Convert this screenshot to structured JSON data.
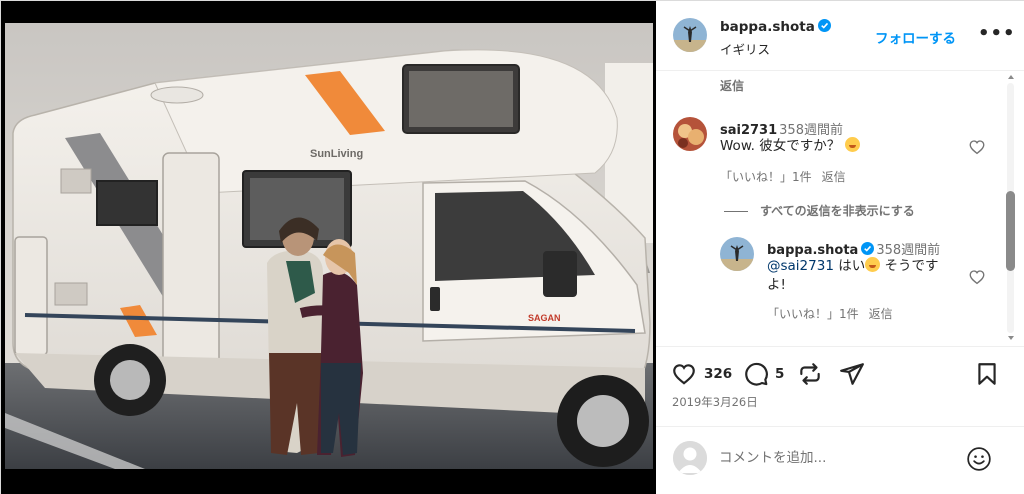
{
  "post": {
    "author": "bappa.shota",
    "location": "イギリス",
    "follow_label": "フォローする",
    "more_label": "•••",
    "likes": "326",
    "comment_count": "5",
    "date": "2019年3月26日",
    "photo_text": {
      "brand": "SunLiving",
      "model": "SAGAN"
    }
  },
  "comments": {
    "top_reply_label": "返信",
    "items": [
      {
        "user": "sai2731",
        "time": "358週間前",
        "text": "Wow. 彼女ですか？",
        "likes_label": "「いいね！」1件",
        "reply_label": "返信"
      }
    ],
    "hide_replies_label": "すべての返信を非表示にする",
    "replies": [
      {
        "user": "bappa.shota",
        "time": "358週間前",
        "mention": "@sai2731",
        "text_before_emoji": " はい",
        "text_after_emoji": " そうです",
        "text_line2": "よ!",
        "likes_label": "「いいね！」1件",
        "reply_label": "返信"
      }
    ]
  },
  "add_comment": {
    "placeholder": "コメントを追加..."
  },
  "icons": {
    "verified": "verified-badge-icon",
    "like": "heart-icon",
    "comment": "comment-bubble-icon",
    "repost": "repost-icon",
    "share": "send-icon",
    "save": "bookmark-icon",
    "emoji": "smiley-icon"
  },
  "colors": {
    "link_blue": "#0095f6",
    "verified_blue": "#0095f6",
    "text": "#262626",
    "muted": "#737373"
  }
}
